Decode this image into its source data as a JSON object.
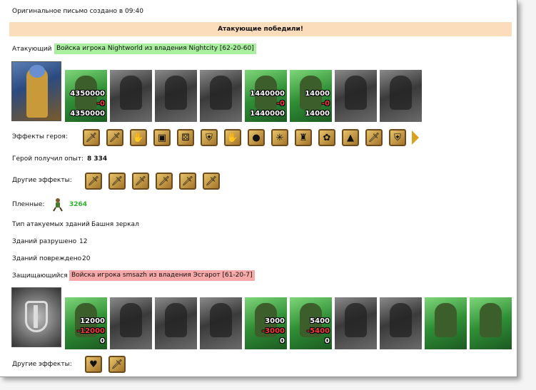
{
  "header": {
    "created_text": "Оригинальное письмо создано в 09:40"
  },
  "banner": {
    "text": "Атакующие победили!"
  },
  "attacker": {
    "label": "Атакующий",
    "tag": "Войска игрока Nightworld из владения Nightcity [62-20-60]",
    "units": [
      {
        "style": "green",
        "top": "4350000",
        "mid": "-0",
        "bottom": "4350000",
        "name": "unit-1"
      },
      {
        "style": "gray",
        "name": "unit-2"
      },
      {
        "style": "gray",
        "name": "unit-3"
      },
      {
        "style": "gray",
        "name": "unit-4"
      },
      {
        "style": "green",
        "top": "1440000",
        "mid": "-0",
        "bottom": "1440000",
        "name": "unit-5"
      },
      {
        "style": "green",
        "top": "14000",
        "mid": "-0",
        "bottom": "14000",
        "name": "unit-6"
      },
      {
        "style": "gray",
        "name": "unit-7"
      },
      {
        "style": "gray",
        "name": "unit-8"
      }
    ]
  },
  "hero_effects": {
    "label": "Эффекты героя:",
    "icons": [
      "sword-icon",
      "sword-icon",
      "hand-icon",
      "chest-icon",
      "dice-icon",
      "shield-icon",
      "hand-icon",
      "sack-icon",
      "web-icon",
      "armor-icon",
      "creature-icon",
      "tent-icon",
      "sword-icon",
      "shield-icon"
    ]
  },
  "experience": {
    "label": "Герой получил опыт:",
    "value": "8 334"
  },
  "other_effects_attacker": {
    "label": "Другие эффекты:",
    "icons": [
      "sword-icon",
      "sword-icon",
      "sword-icon",
      "sword-icon",
      "sword-icon",
      "sword-icon"
    ]
  },
  "prisoners": {
    "label": "Пленные:",
    "value": "3264"
  },
  "building_type": {
    "label": "Тип атакуемых зданий",
    "value": "Башня зеркал"
  },
  "destroyed": {
    "label": "Зданий разрушено",
    "value": "12"
  },
  "damaged": {
    "label": "Зданий повреждено",
    "value": "20"
  },
  "defender": {
    "label": "Защищающийся",
    "tag": "Войска игрока smsazh из владения Эсгарот [61-20-7]",
    "units": [
      {
        "style": "green",
        "top": "12000",
        "mid": "-12000",
        "bottom": "0",
        "name": "unit-1"
      },
      {
        "style": "gray",
        "name": "unit-2"
      },
      {
        "style": "gray",
        "name": "unit-3"
      },
      {
        "style": "gray",
        "name": "unit-4"
      },
      {
        "style": "green",
        "top": "3000",
        "mid": "-3000",
        "bottom": "0",
        "name": "unit-5"
      },
      {
        "style": "green",
        "top": "5400",
        "mid": "-5400",
        "bottom": "0",
        "name": "unit-6"
      },
      {
        "style": "gray",
        "name": "unit-7"
      },
      {
        "style": "gray",
        "name": "unit-8"
      },
      {
        "style": "green",
        "name": "tower-1"
      },
      {
        "style": "green",
        "name": "tower-2"
      }
    ]
  },
  "other_effects_defender": {
    "label": "Другие эффекты:",
    "icons": [
      "heart-icon",
      "sword-icon"
    ]
  }
}
